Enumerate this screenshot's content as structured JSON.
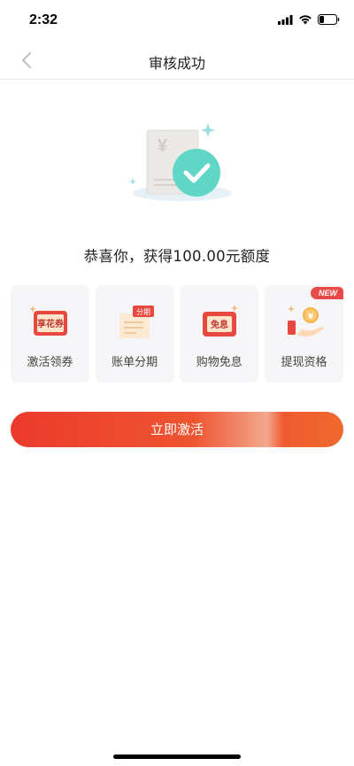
{
  "status_bar": {
    "time": "2:32",
    "icons": [
      "signal-icon",
      "wifi-icon",
      "battery-icon"
    ]
  },
  "nav": {
    "title": "审核成功",
    "back_icon": "chevron-left-icon"
  },
  "illustration": {
    "currency_symbol": "¥",
    "icon": "success-check-icon"
  },
  "headline": "恭喜你，获得100.00元额度",
  "features": [
    {
      "label": "激活领券",
      "icon": "coupon-icon",
      "icon_text": "享花券"
    },
    {
      "label": "账单分期",
      "icon": "bill-installment-icon",
      "icon_text": "分期"
    },
    {
      "label": "购物免息",
      "icon": "interest-free-icon",
      "icon_text": "免息"
    },
    {
      "label": "提现资格",
      "icon": "cash-withdraw-icon",
      "icon_text": "¥",
      "badge": "NEW"
    }
  ],
  "activate_button": {
    "label": "立即激活"
  },
  "colors": {
    "accent_red": "#ec3a2c",
    "accent_orange": "#ef6a2d",
    "success_teal": "#5fd6c6",
    "card_bg": "#f6f6f8"
  }
}
